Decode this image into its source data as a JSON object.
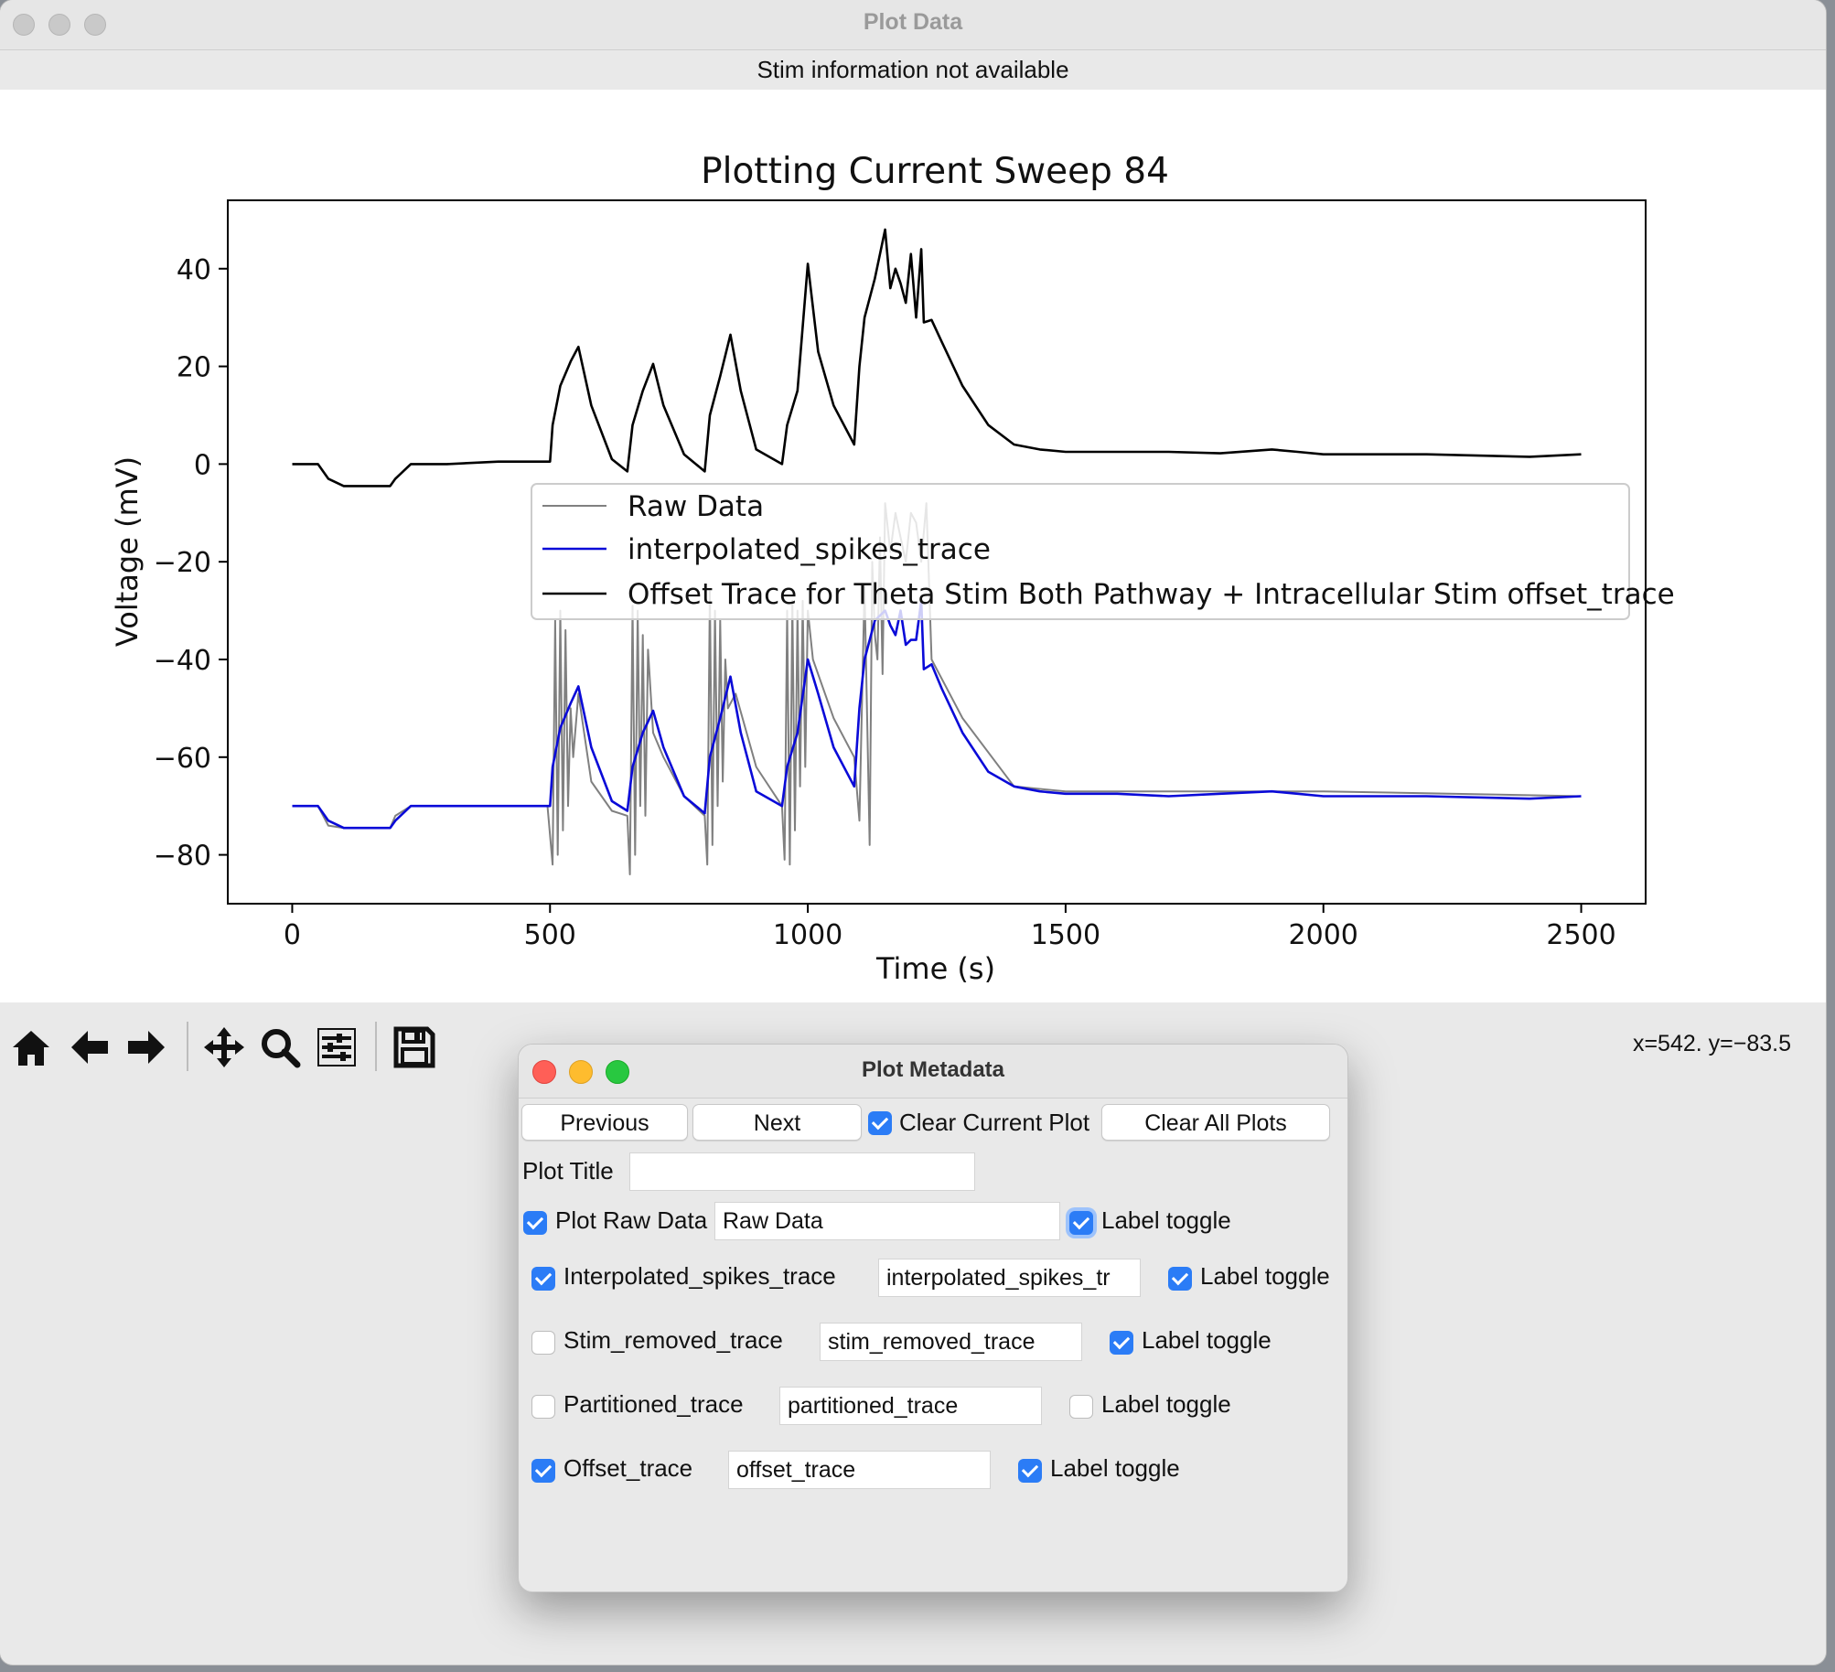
{
  "window": {
    "title": "Plot Data",
    "stim_info": "Stim information not available"
  },
  "chart_data": {
    "type": "line",
    "title": "Plotting Current Sweep 84",
    "xlabel": "Time (s)",
    "ylabel": "Voltage (mV)",
    "xlim": [
      -125,
      2625
    ],
    "ylim": [
      -90,
      54
    ],
    "xticks": [
      "0",
      "500",
      "1000",
      "1500",
      "2000",
      "2500"
    ],
    "yticks": [
      "40",
      "20",
      "0",
      "−20",
      "−40",
      "−60",
      "−80"
    ],
    "legend_location": "center-right",
    "legend": [
      "Raw Data",
      "interpolated_spikes_trace",
      "Offset Trace for Theta Stim Both Pathway + Intracellular Stim offset_trace"
    ],
    "series": [
      {
        "name": "Raw Data",
        "color": "#808080",
        "x": [
          0,
          50,
          70,
          100,
          150,
          190,
          200,
          230,
          300,
          400,
          495,
          505,
          510,
          515,
          520,
          525,
          530,
          535,
          540,
          545,
          555,
          580,
          620,
          650,
          655,
          660,
          665,
          670,
          675,
          680,
          685,
          690,
          700,
          720,
          760,
          800,
          805,
          810,
          815,
          820,
          825,
          830,
          835,
          840,
          845,
          860,
          900,
          950,
          955,
          960,
          965,
          970,
          975,
          980,
          985,
          990,
          995,
          1000,
          1010,
          1050,
          1090,
          1100,
          1110,
          1120,
          1125,
          1130,
          1135,
          1140,
          1145,
          1150,
          1160,
          1170,
          1180,
          1190,
          1200,
          1210,
          1220,
          1230,
          1240,
          1300,
          1400,
          1500,
          2000,
          2500
        ],
        "y": [
          -70,
          -70,
          -74,
          -74.5,
          -74.5,
          -74.5,
          -72,
          -70,
          -70,
          -70,
          -70,
          -82,
          -32,
          -80,
          -30,
          -75,
          -34,
          -70,
          -50,
          -60,
          -47,
          -65,
          -71,
          -72,
          -84,
          -29,
          -80,
          -30,
          -70,
          -35,
          -72,
          -38,
          -55,
          -60,
          -68,
          -72,
          -82,
          -26,
          -78,
          -30,
          -70,
          -32,
          -65,
          -40,
          -50,
          -47,
          -62,
          -70,
          -81,
          -30,
          -82,
          -28,
          -75,
          -30,
          -66,
          -28,
          -62,
          -30,
          -40,
          -52,
          -60,
          -73,
          -25,
          -78,
          -20,
          -35,
          -40,
          -15,
          -43,
          -8,
          -18,
          -10,
          -15,
          -20,
          -10,
          -12,
          -20,
          -8,
          -40,
          -52,
          -66,
          -67,
          -67,
          -68
        ]
      },
      {
        "name": "interpolated_spikes_trace",
        "color": "#0a0ad8",
        "x": [
          0,
          50,
          70,
          100,
          150,
          190,
          200,
          230,
          300,
          400,
          500,
          505,
          520,
          540,
          555,
          580,
          620,
          650,
          660,
          680,
          700,
          720,
          760,
          800,
          810,
          830,
          850,
          870,
          900,
          950,
          960,
          980,
          1000,
          1020,
          1050,
          1090,
          1100,
          1110,
          1130,
          1150,
          1160,
          1170,
          1180,
          1190,
          1200,
          1210,
          1220,
          1225,
          1240,
          1260,
          1300,
          1350,
          1400,
          1450,
          1500,
          1600,
          1700,
          1800,
          1900,
          1950,
          2000,
          2200,
          2400,
          2500
        ],
        "y": [
          -70,
          -70,
          -73,
          -74.5,
          -74.5,
          -74.5,
          -73,
          -70,
          -70,
          -70,
          -70,
          -62,
          -54,
          -49,
          -45.5,
          -58,
          -69,
          -71,
          -62,
          -55,
          -50.5,
          -58,
          -68,
          -71.5,
          -60,
          -52,
          -43.5,
          -55,
          -67,
          -70,
          -62,
          -55,
          -40,
          -47,
          -58,
          -66,
          -50,
          -40,
          -32,
          -30,
          -33,
          -35,
          -30,
          -37,
          -36,
          -36,
          -28,
          -42,
          -41,
          -46,
          -55,
          -63,
          -66,
          -67,
          -67.5,
          -67.5,
          -68,
          -67.5,
          -67,
          -67.5,
          -68,
          -68,
          -68.5,
          -68
        ]
      },
      {
        "name": "Offset Trace for Theta Stim Both Pathway + Intracellular Stim offset_trace",
        "color": "#000000",
        "x": [
          0,
          50,
          70,
          100,
          150,
          190,
          200,
          230,
          300,
          400,
          500,
          505,
          520,
          540,
          555,
          580,
          620,
          650,
          660,
          680,
          700,
          720,
          760,
          800,
          810,
          830,
          850,
          870,
          900,
          950,
          960,
          980,
          1000,
          1020,
          1050,
          1090,
          1100,
          1110,
          1130,
          1150,
          1160,
          1170,
          1180,
          1190,
          1200,
          1210,
          1220,
          1225,
          1240,
          1260,
          1300,
          1350,
          1400,
          1450,
          1500,
          1600,
          1700,
          1800,
          1900,
          1950,
          2000,
          2200,
          2400,
          2500
        ],
        "y": [
          0,
          0,
          -3,
          -4.5,
          -4.5,
          -4.5,
          -3,
          0,
          0,
          0.5,
          0.5,
          8,
          16,
          21,
          24,
          12,
          1,
          -1.5,
          8,
          15,
          20.5,
          12,
          2,
          -1.5,
          10,
          18,
          26.5,
          15,
          3,
          0,
          8,
          15,
          41,
          23,
          12,
          4,
          20,
          30,
          38,
          48,
          36,
          40,
          37,
          33,
          43,
          30,
          44,
          29,
          29.5,
          25,
          16,
          8,
          4,
          3,
          2.5,
          2.5,
          2.5,
          2.2,
          3,
          2.5,
          2,
          2,
          1.5,
          2
        ]
      }
    ]
  },
  "toolbar": {
    "buttons": [
      {
        "name": "home-icon",
        "glyph": "⌂"
      },
      {
        "name": "back-arrow-icon",
        "glyph": "←"
      },
      {
        "name": "forward-arrow-icon",
        "glyph": "→"
      },
      {
        "name": "pan-icon",
        "glyph": "✛"
      },
      {
        "name": "zoom-icon",
        "glyph": "⌕"
      },
      {
        "name": "configure-subplots-icon",
        "glyph": "≡"
      },
      {
        "name": "save-icon",
        "glyph": "▣"
      }
    ],
    "coords": "x=542. y=−83.5"
  },
  "dialog": {
    "title": "Plot Metadata",
    "previous": "Previous",
    "next": "Next",
    "clear_current": "Clear Current Plot",
    "clear_current_checked": true,
    "clear_all": "Clear All Plots",
    "plot_title_label": "Plot Title",
    "plot_title_value": "",
    "rows": [
      {
        "label": "Plot Raw Data",
        "checked": true,
        "value": "Raw Data",
        "toggle_label": "Label toggle",
        "toggle": true
      },
      {
        "label": "Interpolated_spikes_trace",
        "checked": true,
        "value": "interpolated_spikes_tr",
        "toggle_label": "Label toggle",
        "toggle": true
      },
      {
        "label": "Stim_removed_trace",
        "checked": false,
        "value": "stim_removed_trace",
        "toggle_label": "Label toggle",
        "toggle": true
      },
      {
        "label": "Partitioned_trace",
        "checked": false,
        "value": "partitioned_trace",
        "toggle_label": "Label toggle",
        "toggle": false
      },
      {
        "label": "Offset_trace",
        "checked": true,
        "value": "offset_trace",
        "toggle_label": "Label toggle",
        "toggle": true
      }
    ]
  }
}
